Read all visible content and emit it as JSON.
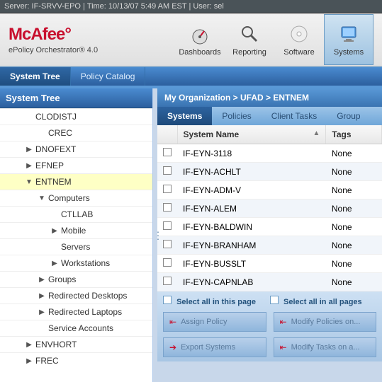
{
  "server_bar": "Server: IF-SRVV-EPO | Time: 10/13/07 5:49 AM EST | User: sel",
  "brand": {
    "name": "McAfee",
    "product": "ePolicy Orchestrator® 4.0"
  },
  "nav": [
    {
      "id": "dashboards",
      "label": "Dashboards"
    },
    {
      "id": "reporting",
      "label": "Reporting"
    },
    {
      "id": "software",
      "label": "Software"
    },
    {
      "id": "systems",
      "label": "Systems"
    }
  ],
  "nav_active": "systems",
  "top_tabs": [
    {
      "id": "system-tree",
      "label": "System Tree"
    },
    {
      "id": "policy-catalog",
      "label": "Policy Catalog"
    }
  ],
  "top_tab_active": "system-tree",
  "sidebar_title": "System Tree",
  "tree": [
    {
      "label": "CLODISTJ",
      "ind": 1,
      "caret": ""
    },
    {
      "label": "CREC",
      "ind": 2,
      "caret": ""
    },
    {
      "label": "DNOFEXT",
      "ind": 1,
      "caret": "▶"
    },
    {
      "label": "EFNEP",
      "ind": 1,
      "caret": "▶"
    },
    {
      "label": "ENTNEM",
      "ind": 1,
      "caret": "▼",
      "sel": true
    },
    {
      "label": "Computers",
      "ind": 2,
      "caret": "▼"
    },
    {
      "label": "CTLLAB",
      "ind": 3,
      "caret": ""
    },
    {
      "label": "Mobile",
      "ind": 3,
      "caret": "▶"
    },
    {
      "label": "Servers",
      "ind": 3,
      "caret": ""
    },
    {
      "label": "Workstations",
      "ind": 3,
      "caret": "▶"
    },
    {
      "label": "Groups",
      "ind": 2,
      "caret": "▶"
    },
    {
      "label": "Redirected Desktops",
      "ind": 2,
      "caret": "▶"
    },
    {
      "label": "Redirected Laptops",
      "ind": 2,
      "caret": "▶"
    },
    {
      "label": "Service Accounts",
      "ind": 2,
      "caret": ""
    },
    {
      "label": "ENVHORT",
      "ind": 1,
      "caret": "▶"
    },
    {
      "label": "FREC",
      "ind": 1,
      "caret": "▶"
    }
  ],
  "breadcrumb": [
    "My Organization",
    "UFAD",
    "ENTNEM"
  ],
  "breadcrumb_sep": " > ",
  "sub_tabs": [
    {
      "id": "systems",
      "label": "Systems"
    },
    {
      "id": "policies",
      "label": "Policies"
    },
    {
      "id": "client-tasks",
      "label": "Client Tasks"
    },
    {
      "id": "group",
      "label": "Group"
    }
  ],
  "sub_tab_active": "systems",
  "columns": [
    "",
    "System Name",
    "Tags"
  ],
  "rows": [
    {
      "name": "IF-EYN-3118",
      "tags": "None"
    },
    {
      "name": "IF-EYN-ACHLT",
      "tags": "None"
    },
    {
      "name": "IF-EYN-ADM-V",
      "tags": "None"
    },
    {
      "name": "IF-EYN-ALEM",
      "tags": "None"
    },
    {
      "name": "IF-EYN-BALDWIN",
      "tags": "None"
    },
    {
      "name": "IF-EYN-BRANHAM",
      "tags": "None"
    },
    {
      "name": "IF-EYN-BUSSLT",
      "tags": "None"
    },
    {
      "name": "IF-EYN-CAPNLAB",
      "tags": "None"
    }
  ],
  "select": {
    "page": "Select all in this page",
    "all": "Select all in all pages"
  },
  "actions": {
    "assign": "Assign Policy",
    "modify_policies": "Modify Policies on...",
    "export": "Export Systems",
    "modify_tasks": "Modify Tasks on a..."
  }
}
